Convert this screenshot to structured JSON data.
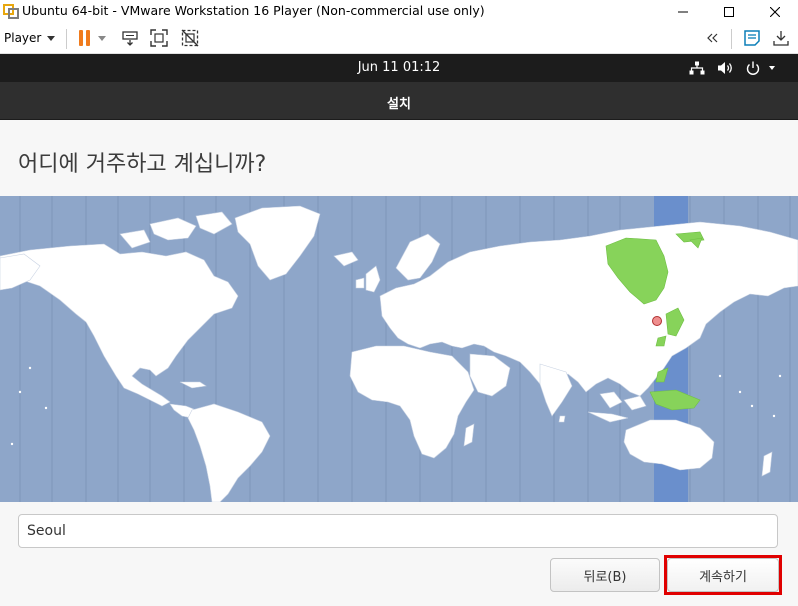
{
  "window": {
    "title": "Ubuntu 64-bit - VMware Workstation 16 Player (Non-commercial use only)",
    "controls": {
      "minimize": "—",
      "maximize": "☐",
      "close": "✕"
    }
  },
  "toolbar": {
    "player_label": "Player",
    "icons": [
      "pause-icon",
      "send-ctrl-alt-del-icon",
      "fit-guest-icon",
      "unity-icon",
      "collapse-toolbar-icon",
      "notes-icon",
      "download-icon"
    ],
    "accent": "#f07b1d"
  },
  "topbar": {
    "clock": "Jun 11  01:12",
    "tray_icons": [
      "network-icon",
      "volume-icon",
      "power-icon"
    ]
  },
  "installer": {
    "header_title": "설치",
    "heading": "어디에 거주하고 계십니까?",
    "location_value": "Seoul",
    "back_label": "뒤로(B)",
    "continue_label": "계속하기",
    "highlight_color": "#e00000"
  },
  "map": {
    "ocean_color": "#8ea6c9",
    "land_color": "#ffffff",
    "selected_zone_color": "#87d35a",
    "selected_band_color": "#6a8fcc",
    "marker": "seoul-marker"
  }
}
